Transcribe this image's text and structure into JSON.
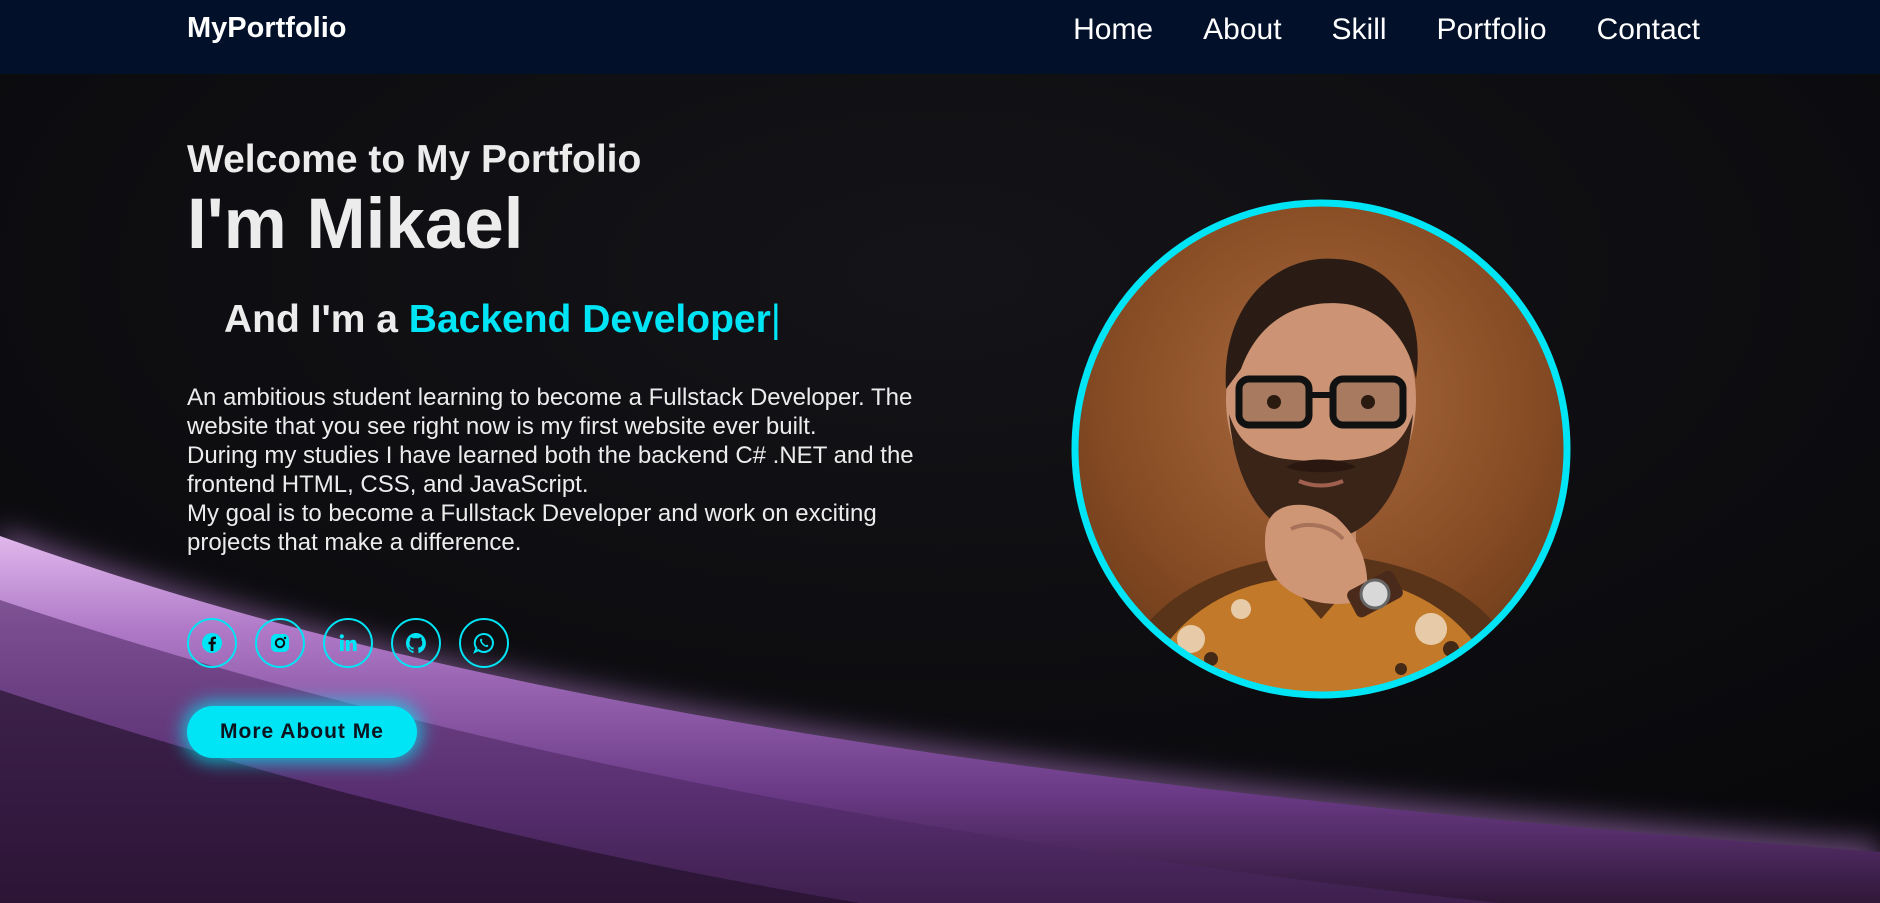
{
  "header": {
    "logo": "MyPortfolio",
    "nav": [
      "Home",
      "About",
      "Skill",
      "Portfolio",
      "Contact"
    ]
  },
  "hero": {
    "welcome": "Welcome to My Portfolio",
    "name": "I'm Mikael",
    "role_prefix": "And I'm a ",
    "role": "Backend Developer",
    "cursor": "|",
    "bio": [
      "An ambitious student learning to become a Fullstack Developer. The website that you see right now is my first website ever built.",
      "During my studies I have learned both the backend C# .NET and the frontend HTML, CSS, and JavaScript.",
      "My goal is to become a Fullstack Developer and work on exciting projects that make a difference."
    ],
    "cta": "More About Me"
  },
  "social": [
    "facebook-icon",
    "instagram-icon",
    "linkedin-icon",
    "github-icon",
    "whatsapp-icon"
  ],
  "colors": {
    "accent": "#00e5f5",
    "header_bg": "#02102a",
    "page_bg": "#0c0c10",
    "glow": "#b07ac8"
  }
}
